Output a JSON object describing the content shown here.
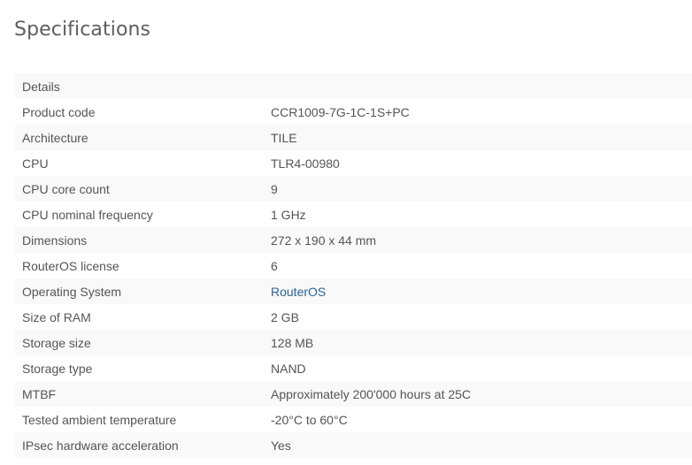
{
  "page": {
    "title": "Specifications"
  },
  "specs": {
    "header": "Details",
    "rows": [
      {
        "label": "Product code",
        "value": "CCR1009-7G-1C-1S+PC"
      },
      {
        "label": "Architecture",
        "value": "TILE"
      },
      {
        "label": "CPU",
        "value": "TLR4-00980"
      },
      {
        "label": "CPU core count",
        "value": "9"
      },
      {
        "label": "CPU nominal frequency",
        "value": "1 GHz"
      },
      {
        "label": "Dimensions",
        "value": "272 x 190 x 44 mm"
      },
      {
        "label": "RouterOS license",
        "value": "6"
      },
      {
        "label": "Operating System",
        "value": "RouterOS"
      },
      {
        "label": "Size of RAM",
        "value": "2 GB"
      },
      {
        "label": "Storage size",
        "value": "128 MB"
      },
      {
        "label": "Storage type",
        "value": "NAND"
      },
      {
        "label": "MTBF",
        "value": "Approximately 200'000 hours at 25C"
      },
      {
        "label": "Tested ambient temperature",
        "value": "-20°C to 60°C"
      },
      {
        "label": "IPsec hardware acceleration",
        "value": "Yes"
      }
    ]
  },
  "colors": {
    "link": "#2a6496",
    "text": "#555555",
    "title": "#5e5e5e",
    "stripe": "#f9f9f9"
  }
}
